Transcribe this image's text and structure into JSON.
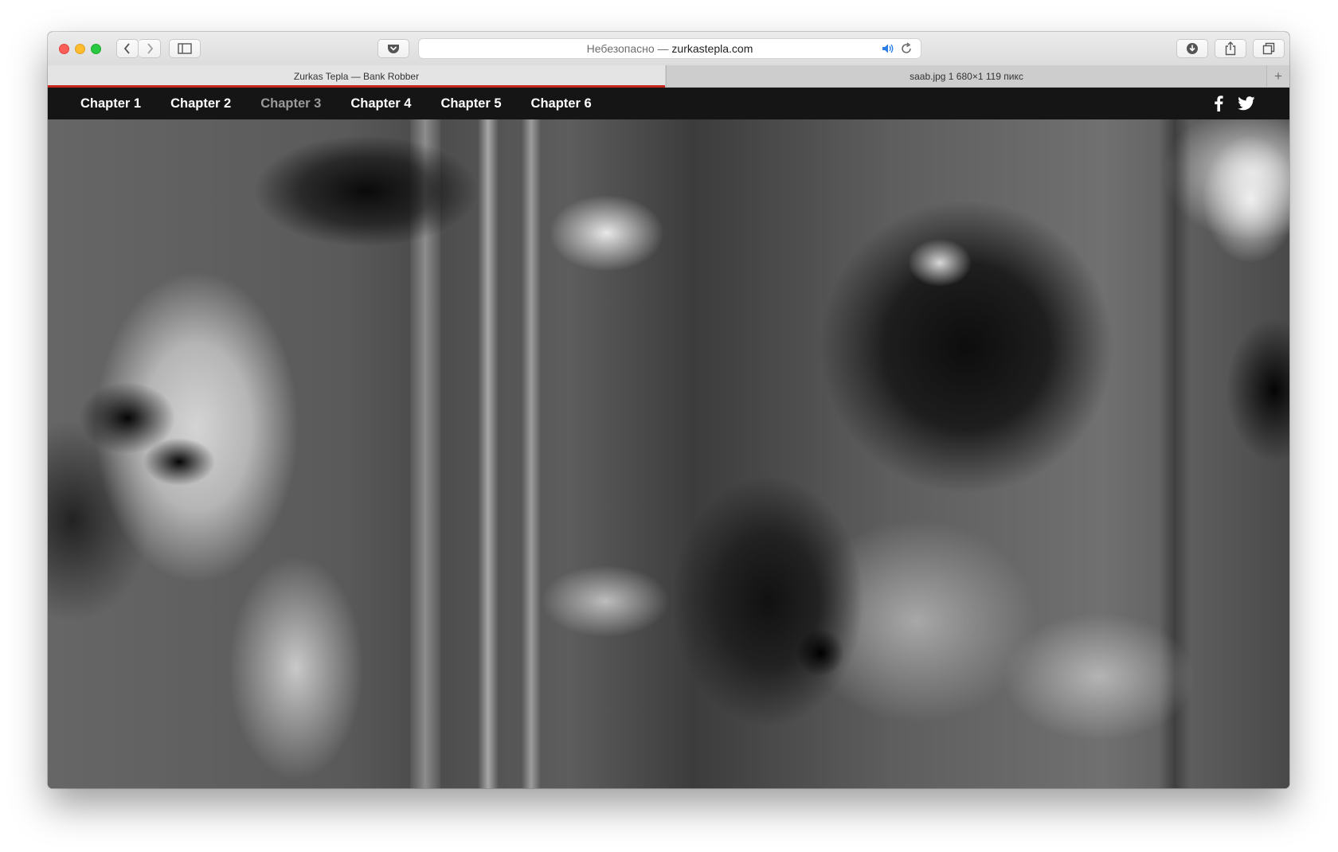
{
  "browser": {
    "address": {
      "insecure_label": "Небезопасно",
      "separator": " — ",
      "host": "zurkastepla.com"
    },
    "tabs": [
      {
        "label": "Zurkas Tepla — Bank Robber",
        "active": true
      },
      {
        "label": "saab.jpg 1 680×1 119 пикс",
        "active": false
      }
    ],
    "new_tab_symbol": "+"
  },
  "site": {
    "chapters": [
      {
        "label": "Chapter 1",
        "active": false
      },
      {
        "label": "Chapter 2",
        "active": false
      },
      {
        "label": "Chapter 3",
        "active": true
      },
      {
        "label": "Chapter 4",
        "active": false
      },
      {
        "label": "Chapter 5",
        "active": false
      },
      {
        "label": "Chapter 6",
        "active": false
      }
    ],
    "social": [
      "facebook-icon",
      "twitter-icon"
    ]
  },
  "colors": {
    "tab_underline": "#c4261d",
    "nav_background": "#151515",
    "chapter_text": "#ffffff",
    "chapter_active_text": "#9a9a9a"
  }
}
